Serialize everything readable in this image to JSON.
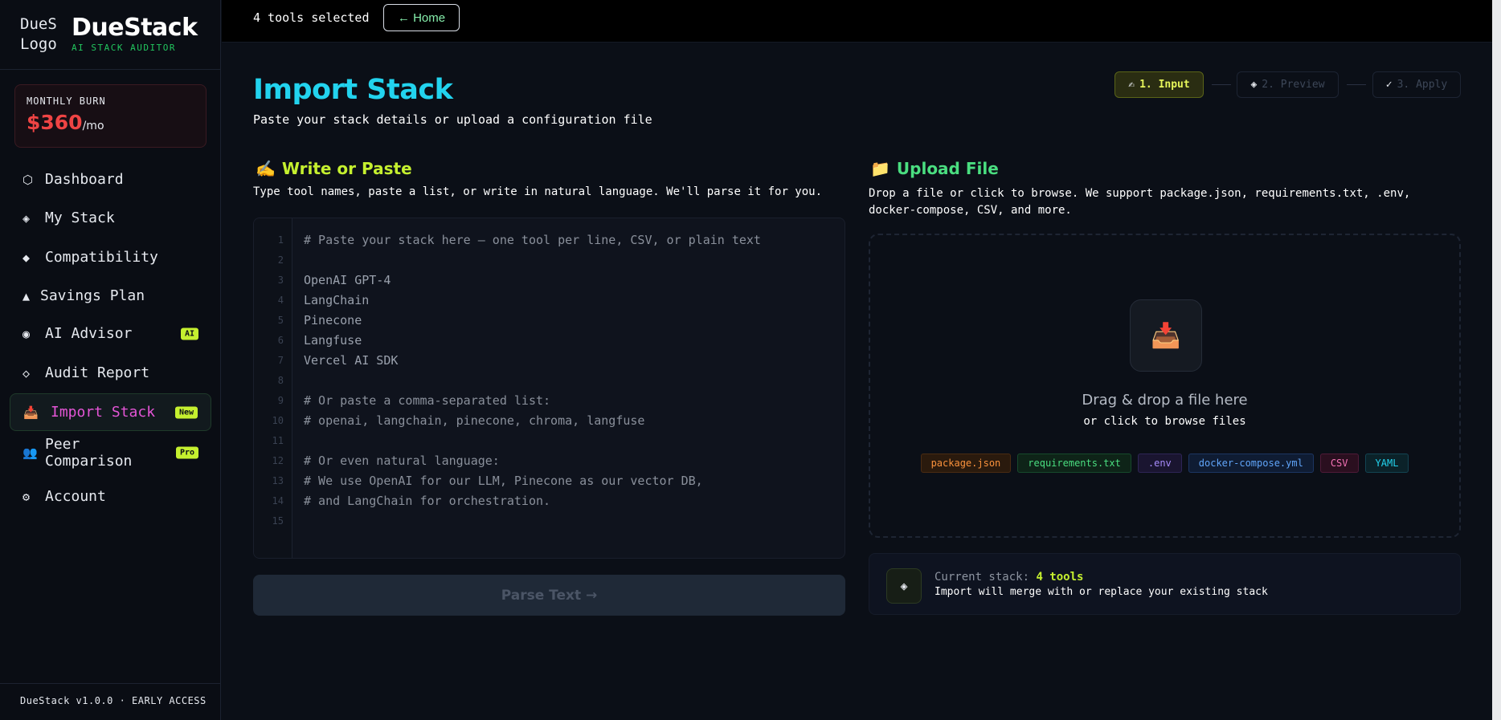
{
  "brand": {
    "logo_alt": "DueS Logo",
    "name": "DueStack",
    "tagline": "AI STACK AUDITOR"
  },
  "burn": {
    "label": "MONTHLY BURN",
    "amount": "$360",
    "unit": "/mo"
  },
  "nav": [
    {
      "icon": "⬡",
      "label": "Dashboard"
    },
    {
      "icon": "◈",
      "label": "My Stack"
    },
    {
      "icon": "◆",
      "label": "Compatibility"
    },
    {
      "icon": "▲",
      "label": "Savings Plan"
    },
    {
      "icon": "◉",
      "label": "AI Advisor",
      "badge": "AI"
    },
    {
      "icon": "◇",
      "label": "Audit Report"
    },
    {
      "icon": "📥",
      "label": "Import Stack",
      "badge": "New",
      "active": true
    },
    {
      "icon": "👥",
      "label": "Peer Comparison",
      "badge": "Pro"
    },
    {
      "icon": "⚙",
      "label": "Account"
    }
  ],
  "version": "DueStack v1.0.0 · EARLY ACCESS",
  "topbar": {
    "tools_selected": "4 tools selected",
    "home_label": "← Home"
  },
  "page": {
    "title": "Import Stack",
    "subtitle": "Paste your stack details or upload a configuration file"
  },
  "steps": [
    {
      "icon": "✍",
      "label": "1. Input"
    },
    {
      "icon": "◈",
      "label": "2. Preview"
    },
    {
      "icon": "✓",
      "label": "3. Apply"
    }
  ],
  "write": {
    "icon": "✍️",
    "title": "Write or Paste",
    "description": "Type tool names, paste a list, or write in natural language. We'll parse it for you.",
    "lines": [
      "# Paste your stack here — one tool per line, CSV, or plain text",
      "",
      "OpenAI GPT-4",
      "LangChain",
      "Pinecone",
      "Langfuse",
      "Vercel AI SDK",
      "",
      "# Or paste a comma-separated list:",
      "# openai, langchain, pinecone, chroma, langfuse",
      "",
      "# Or even natural language:",
      "# We use OpenAI for our LLM, Pinecone as our vector DB,",
      "# and LangChain for orchestration.",
      ""
    ],
    "parse_label": "Parse Text →"
  },
  "upload": {
    "icon": "📁",
    "title": "Upload File",
    "description": "Drop a file or click to browse. We support package.json, requirements.txt, .env, docker-compose, CSV, and more.",
    "drop_icon": "📥",
    "drop_title": "Drag & drop a file here",
    "drop_sub": "or click to browse files",
    "tags": [
      "package.json",
      "requirements.txt",
      ".env",
      "docker-compose.yml",
      "CSV",
      "YAML"
    ]
  },
  "current": {
    "icon": "◈",
    "prefix": "Current stack:",
    "count": "4 tools",
    "note": "Import will merge with or replace your existing stack"
  }
}
